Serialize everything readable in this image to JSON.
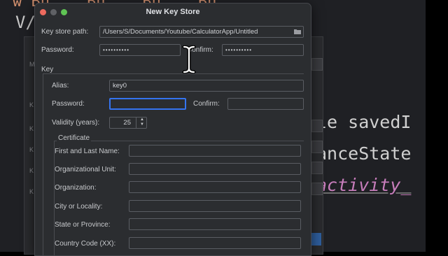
{
  "editor": {
    "code_top": "w Bu.., Bu.., Bu.., Bu..,",
    "code_frag": "V/i",
    "line1_text": "le saved",
    "line1_cursor": "I",
    "line2_text": "anceState",
    "line3_text": "activity_"
  },
  "parent_dialog": {
    "labels": [
      "M",
      "K",
      "K",
      "K",
      "K",
      "K"
    ]
  },
  "dialog": {
    "title": "New Key Store",
    "key_store_path_label": "Key store path:",
    "key_store_path_value": "/Users/S/Documents/Youtube/CalculatorApp/Untitled",
    "password_label": "Password:",
    "password_value": "••••••••••",
    "confirm_label": "Confirm:",
    "confirm_value": "••••••••••",
    "key_group_label": "Key",
    "key": {
      "alias_label": "Alias:",
      "alias_value": "key0",
      "password_label": "Password:",
      "password_value": "",
      "confirm_label": "Confirm:",
      "confirm_value": "",
      "validity_label": "Validity (years):",
      "validity_value": "25",
      "certificate_group_label": "Certificate",
      "certificate": {
        "first_last_name_label": "First and Last Name:",
        "org_unit_label": "Organizational Unit:",
        "organization_label": "Organization:",
        "city_label": "City or Locality:",
        "state_label": "State or Province:",
        "country_label": "Country Code (XX):"
      }
    }
  },
  "colors": {
    "accent": "#3574f0",
    "dialog_bg": "#2b2d30",
    "editor_bg": "#1f2024",
    "keyword": "#cf8e6d",
    "purple": "#c77dbb"
  }
}
